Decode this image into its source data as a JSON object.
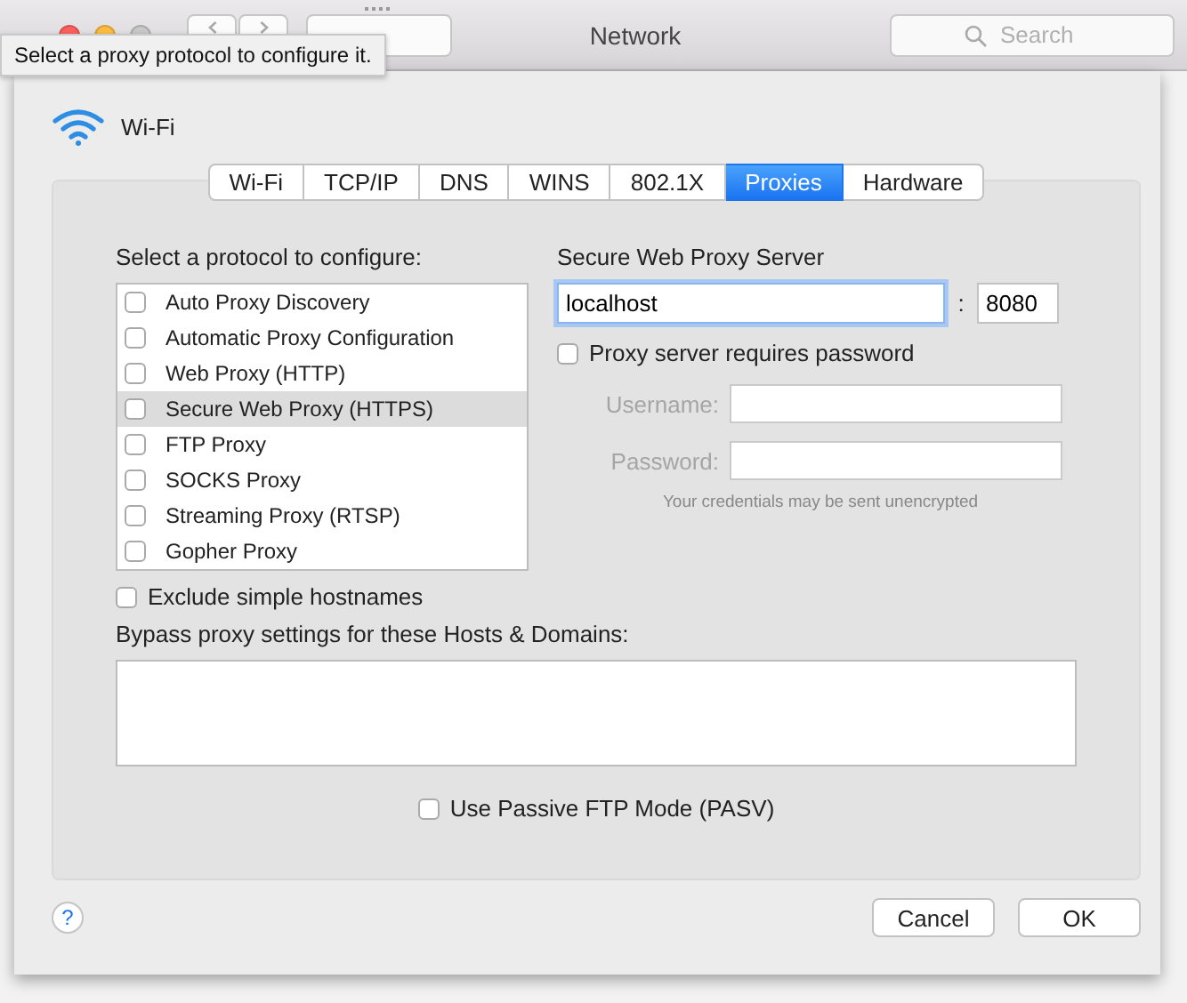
{
  "toolbar": {
    "title": "Network",
    "search": {
      "placeholder": "Search"
    }
  },
  "tooltip": "Select a proxy protocol to configure it.",
  "interface": {
    "name": "Wi-Fi"
  },
  "tabs": [
    {
      "label": "Wi-Fi",
      "selected": false
    },
    {
      "label": "TCP/IP",
      "selected": false
    },
    {
      "label": "DNS",
      "selected": false
    },
    {
      "label": "WINS",
      "selected": false
    },
    {
      "label": "802.1X",
      "selected": false
    },
    {
      "label": "Proxies",
      "selected": true
    },
    {
      "label": "Hardware",
      "selected": false
    }
  ],
  "protocols": {
    "label": "Select a protocol to configure:",
    "items": [
      {
        "label": "Auto Proxy Discovery",
        "checked": false,
        "selected": false
      },
      {
        "label": "Automatic Proxy Configuration",
        "checked": false,
        "selected": false
      },
      {
        "label": "Web Proxy (HTTP)",
        "checked": false,
        "selected": false
      },
      {
        "label": "Secure Web Proxy (HTTPS)",
        "checked": false,
        "selected": true
      },
      {
        "label": "FTP Proxy",
        "checked": false,
        "selected": false
      },
      {
        "label": "SOCKS Proxy",
        "checked": false,
        "selected": false
      },
      {
        "label": "Streaming Proxy (RTSP)",
        "checked": false,
        "selected": false
      },
      {
        "label": "Gopher Proxy",
        "checked": false,
        "selected": false
      }
    ]
  },
  "server": {
    "title": "Secure Web Proxy Server",
    "host": "localhost",
    "separator": ":",
    "port": "8080",
    "requires_password": {
      "label": "Proxy server requires password",
      "checked": false
    },
    "username": {
      "label": "Username:",
      "disabled": true
    },
    "password": {
      "label": "Password:",
      "disabled": true
    },
    "note": "Your credentials may be sent unencrypted"
  },
  "exclude_simple_hostnames": {
    "label": "Exclude simple hostnames",
    "checked": false
  },
  "bypass": {
    "label": "Bypass proxy settings for these Hosts & Domains:"
  },
  "passive_ftp": {
    "label": "Use Passive FTP Mode (PASV)",
    "checked": false
  },
  "help": "?",
  "buttons": [
    {
      "label": "Cancel"
    },
    {
      "label": "OK"
    }
  ]
}
